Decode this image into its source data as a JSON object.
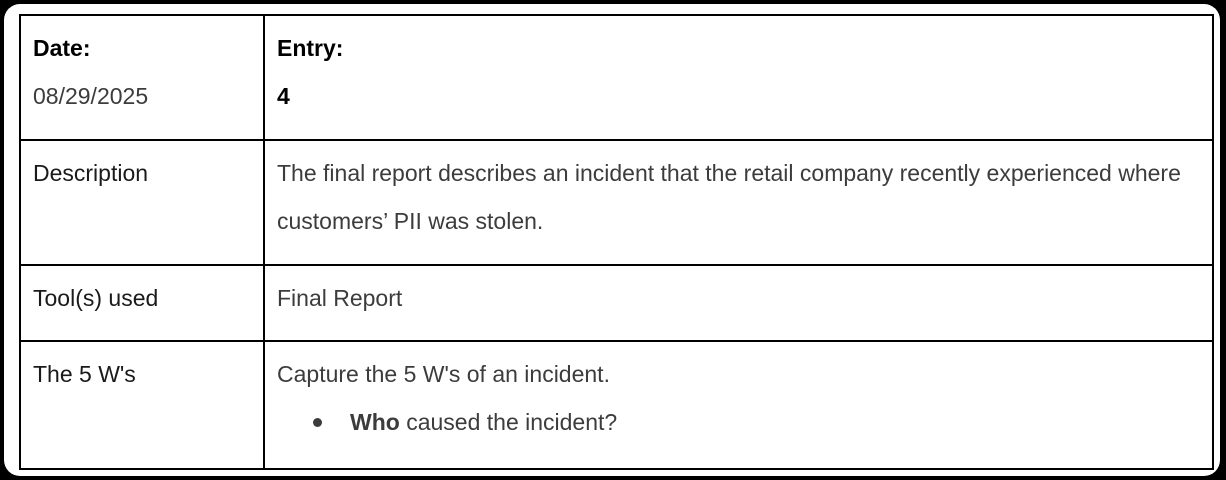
{
  "header": {
    "date_label": "Date:",
    "date_value": "08/29/2025",
    "entry_label": "Entry:",
    "entry_value": "4"
  },
  "rows": {
    "description": {
      "label": "Description",
      "text": "The final report describes an incident that the retail company recently experienced where customers’ PII was stolen."
    },
    "tools": {
      "label": "Tool(s) used",
      "text": "Final Report"
    },
    "five_ws": {
      "label": "The 5 W's",
      "intro": "Capture the 5 W's of an incident.",
      "items": [
        {
          "bold": "Who",
          "rest": " caused the incident?"
        }
      ]
    }
  },
  "colors": {
    "page_background": "#000000",
    "sheet_background": "#ffffff",
    "border": "#000000",
    "text_muted": "#3c3c3c"
  }
}
